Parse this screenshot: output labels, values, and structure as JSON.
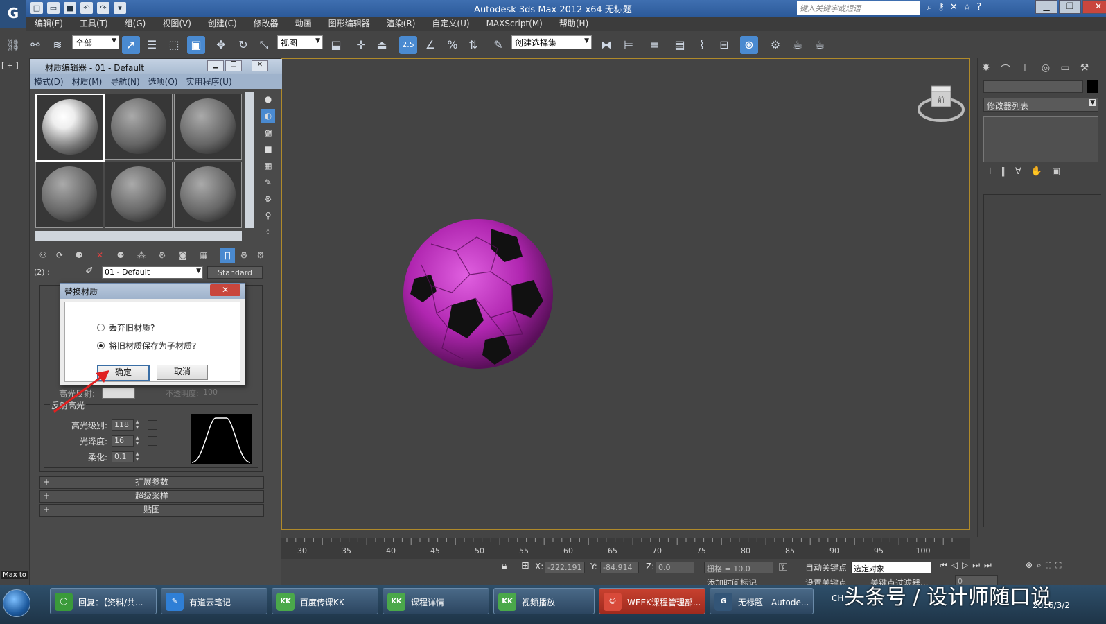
{
  "app": {
    "title": "Autodesk 3ds Max  2012 x64      无标题",
    "logo": "3ds-max-logo",
    "search_placeholder": "键入关键字或短语"
  },
  "menubar": [
    "编辑(E)",
    "工具(T)",
    "组(G)",
    "视图(V)",
    "创建(C)",
    "修改器",
    "动画",
    "图形编辑器",
    "渲染(R)",
    "自定义(U)",
    "MAXScript(M)",
    "帮助(H)"
  ],
  "toolbar": {
    "selection_filter": "全部",
    "reference_coord": "视图",
    "named_selection": "创建选择集",
    "snap_label": "2.5"
  },
  "viewport": {
    "label": "[ + ]",
    "viewcube_label": "前",
    "accent_color": "#b08a2a",
    "object_color": "#b026b0"
  },
  "material_editor": {
    "title": "材质编辑器 - 01 - Default",
    "menu": [
      "模式(D)",
      "材质(M)",
      "导航(N)",
      "选项(O)",
      "实用程序(U)"
    ],
    "slot_count_label": "(2) :",
    "material_name": "01 - Default",
    "material_type": "Standard",
    "spec_section_label": "反射高光",
    "params": [
      {
        "label": "高光级别:",
        "value": "118"
      },
      {
        "label": "光泽度:",
        "value": "16"
      },
      {
        "label": "柔化:",
        "value": "0.1"
      }
    ],
    "partial_labels": {
      "spec_color": "高光反射:",
      "opacity": "不透明度:",
      "opacity_value": "100"
    },
    "rollouts": [
      "扩展参数",
      "超级采样",
      "贴图"
    ]
  },
  "dialog": {
    "title": "替换材质",
    "options": [
      {
        "label": "丢弃旧材质?",
        "selected": false
      },
      {
        "label": "将旧材质保存为子材质?",
        "selected": true
      }
    ],
    "ok": "确定",
    "cancel": "取消"
  },
  "command_panel": {
    "modifier_list": "修改器列表"
  },
  "timeline": {
    "ticks": [
      "30",
      "35",
      "40",
      "45",
      "50",
      "55",
      "60",
      "65",
      "70",
      "75",
      "80",
      "85",
      "90",
      "95",
      "100"
    ]
  },
  "status": {
    "x_label": "X:",
    "x_value": "-222.191",
    "y_label": "Y:",
    "y_value": "-84.914",
    "z_label": "Z:",
    "z_value": "0.0",
    "grid": "栅格 = 10.0",
    "auto_key": "自动关键点",
    "set_key": "设置关键点",
    "selected_object": "选定对象",
    "add_time_tag": "添加时间标记",
    "key_filters": "关键点过滤器...",
    "frame": "0"
  },
  "left_strip": {
    "max_label": "Max to"
  },
  "taskbar": {
    "items": [
      {
        "label": "回复：【资料/共...",
        "icon": "chat-icon",
        "color": "#3a9a3a"
      },
      {
        "label": "有道云笔记",
        "icon": "note-icon",
        "color": "#2f7fd6"
      },
      {
        "label": "百度传课KK",
        "icon": "kk-icon",
        "color": "#4aa84a"
      },
      {
        "label": "课程详情",
        "icon": "kk-icon",
        "color": "#4aa84a"
      },
      {
        "label": "视频播放",
        "icon": "kk-icon",
        "color": "#4aa84a"
      },
      {
        "label": "WEEK课程管理部...",
        "icon": "user-icon",
        "color": "#d84a3a"
      },
      {
        "label": "无标题 - Autode...",
        "icon": "3ds-max-icon",
        "color": "#335577"
      }
    ],
    "tray_label": "CH",
    "date": "2016/3/2",
    "watermark": "头条号 / 设计师随口说"
  }
}
